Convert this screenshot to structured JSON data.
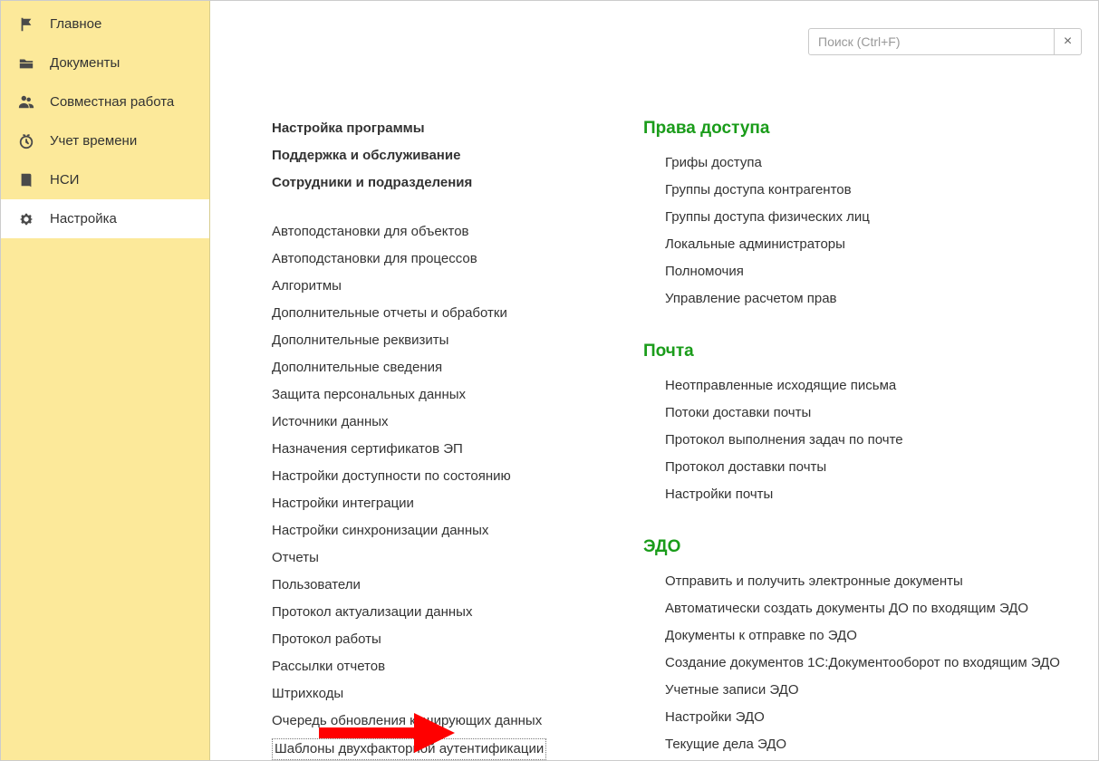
{
  "sidebar": {
    "items": [
      {
        "icon": "flag-icon",
        "label": "Главное"
      },
      {
        "icon": "folder-icon",
        "label": "Документы"
      },
      {
        "icon": "people-icon",
        "label": "Совместная работа"
      },
      {
        "icon": "clock-icon",
        "label": "Учет времени"
      },
      {
        "icon": "book-icon",
        "label": "НСИ"
      },
      {
        "icon": "gear-icon",
        "label": "Настройка"
      }
    ],
    "activeIndex": 5
  },
  "search": {
    "placeholder": "Поиск (Ctrl+F)",
    "clearLabel": "×"
  },
  "columns": {
    "left": {
      "bold": [
        "Настройка программы",
        "Поддержка и обслуживание",
        "Сотрудники и подразделения"
      ],
      "items": [
        "Автоподстановки для объектов",
        "Автоподстановки для процессов",
        "Алгоритмы",
        "Дополнительные отчеты и обработки",
        "Дополнительные реквизиты",
        "Дополнительные сведения",
        "Защита персональных данных",
        "Источники данных",
        "Назначения сертификатов ЭП",
        "Настройки доступности по состоянию",
        "Настройки интеграции",
        "Настройки синхронизации данных",
        "Отчеты",
        "Пользователи",
        "Протокол актуализации данных",
        "Протокол работы",
        "Рассылки отчетов",
        "Штрихкоды",
        "Очередь обновления кэширующих данных"
      ],
      "highlighted": "Шаблоны двухфакторной аутентификации"
    },
    "right": {
      "sections": [
        {
          "title": "Права доступа",
          "items": [
            "Грифы доступа",
            "Группы доступа контрагентов",
            "Группы доступа физических лиц",
            "Локальные администраторы",
            "Полномочия",
            "Управление расчетом прав"
          ]
        },
        {
          "title": "Почта",
          "items": [
            "Неотправленные исходящие письма",
            "Потоки доставки почты",
            "Протокол выполнения задач по почте",
            "Протокол доставки почты",
            "Настройки почты"
          ]
        },
        {
          "title": "ЭДО",
          "items": [
            "Отправить и получить электронные документы",
            "Автоматически создать документы ДО по входящим ЭДО",
            "Документы к отправке по ЭДО",
            "Создание документов 1С:Документооборот по входящим ЭДО",
            "Учетные записи ЭДО",
            "Настройки ЭДО",
            "Текущие дела ЭДО"
          ]
        }
      ]
    }
  }
}
